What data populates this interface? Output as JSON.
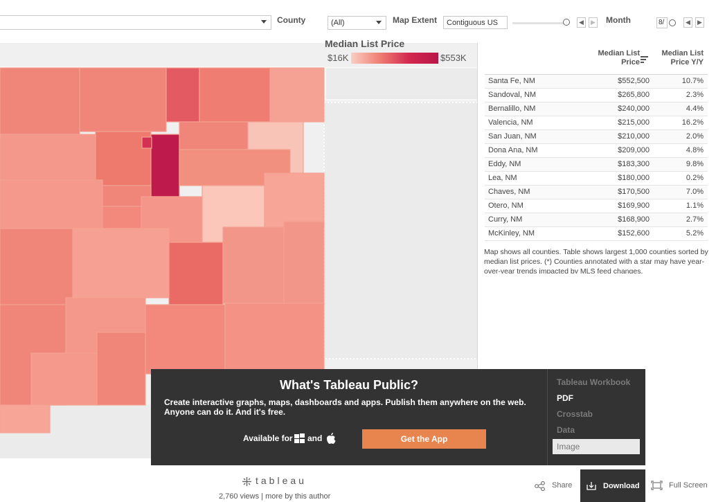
{
  "filters": {
    "state_value": "",
    "county_label": "County",
    "county_value": "(All)",
    "map_extent_label": "Map Extent",
    "map_extent_value": "Contiguous US",
    "month_label": "Month",
    "month_value": "8/",
    "prev_icon": "chevron-left-icon",
    "next_icon": "chevron-right-icon"
  },
  "legend": {
    "title": "Median List Price",
    "min": "$16K",
    "max": "$553K",
    "colors": [
      "#f9cfc4",
      "#ef7d72",
      "#d2284f",
      "#b91748"
    ]
  },
  "table": {
    "col_price": "Median List Price",
    "col_yy": "Median List Price Y/Y",
    "rows": [
      {
        "name": "Santa Fe, NM",
        "price": "$552,500",
        "yy": "10.7%"
      },
      {
        "name": "Sandoval, NM",
        "price": "$265,800",
        "yy": "2.3%"
      },
      {
        "name": "Bernalillo, NM",
        "price": "$240,000",
        "yy": "4.4%"
      },
      {
        "name": "Valencia, NM",
        "price": "$215,000",
        "yy": "16.2%"
      },
      {
        "name": "San Juan, NM",
        "price": "$210,000",
        "yy": "2.0%"
      },
      {
        "name": "Dona Ana, NM",
        "price": "$209,000",
        "yy": "4.8%"
      },
      {
        "name": "Eddy, NM",
        "price": "$183,300",
        "yy": "9.8%"
      },
      {
        "name": "Lea, NM",
        "price": "$180,000",
        "yy": "0.2%"
      },
      {
        "name": "Chaves, NM",
        "price": "$170,500",
        "yy": "7.0%"
      },
      {
        "name": "Otero, NM",
        "price": "$169,900",
        "yy": "1.1%"
      },
      {
        "name": "Curry, NM",
        "price": "$168,900",
        "yy": "2.7%"
      },
      {
        "name": "McKinley, NM",
        "price": "$152,600",
        "yy": "5.2%"
      }
    ],
    "note": "Map shows all counties. Table shows largest 1,000 counties sorted by median list prices. (*) Counties annotated with a star may have year-over-year trends impacted by MLS feed changes."
  },
  "overlay": {
    "title": "What's Tableau Public?",
    "text": "Create interactive graphs, maps, dashboards and apps. Publish them anywhere on the web. Anyone can do it. And it's free.",
    "available_for": "Available for",
    "and": "and",
    "get_app": "Get the App",
    "download_options": [
      "Tableau Workbook",
      "PDF",
      "Crosstab",
      "Data",
      "Image"
    ]
  },
  "footer": {
    "logo": "tableau",
    "views": "2,760 views",
    "more": "more by this author",
    "share": "Share",
    "download": "Download",
    "fullscreen": "Full Screen"
  }
}
